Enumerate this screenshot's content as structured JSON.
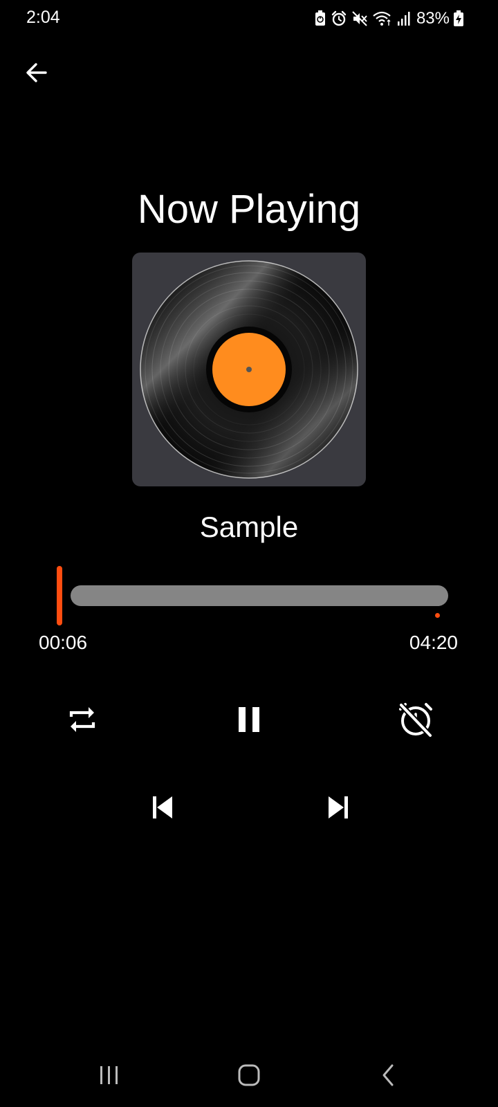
{
  "status_bar": {
    "time": "2:04",
    "battery_percent": "83%",
    "icons": [
      "battery-saver-icon",
      "alarm-icon",
      "mute-icon",
      "wifi-icon",
      "signal-icon",
      "battery-charging-icon"
    ]
  },
  "header": {
    "back_icon": "arrow-left-icon"
  },
  "title": "Now Playing",
  "album_art": {
    "icon": "vinyl-record",
    "label_color": "#ff8c1e"
  },
  "track": {
    "name": "Sample"
  },
  "playback": {
    "current_time": "00:06",
    "total_time": "04:20",
    "accent_color": "#ff4d10"
  },
  "controls": {
    "repeat_icon": "repeat-icon",
    "pause_icon": "pause-icon",
    "timer_off_icon": "timer-off-icon",
    "previous_icon": "skip-previous-icon",
    "next_icon": "skip-next-icon"
  },
  "system_nav": {
    "recents_icon": "recent-apps-icon",
    "home_icon": "home-icon",
    "back_icon": "back-chevron-icon"
  }
}
